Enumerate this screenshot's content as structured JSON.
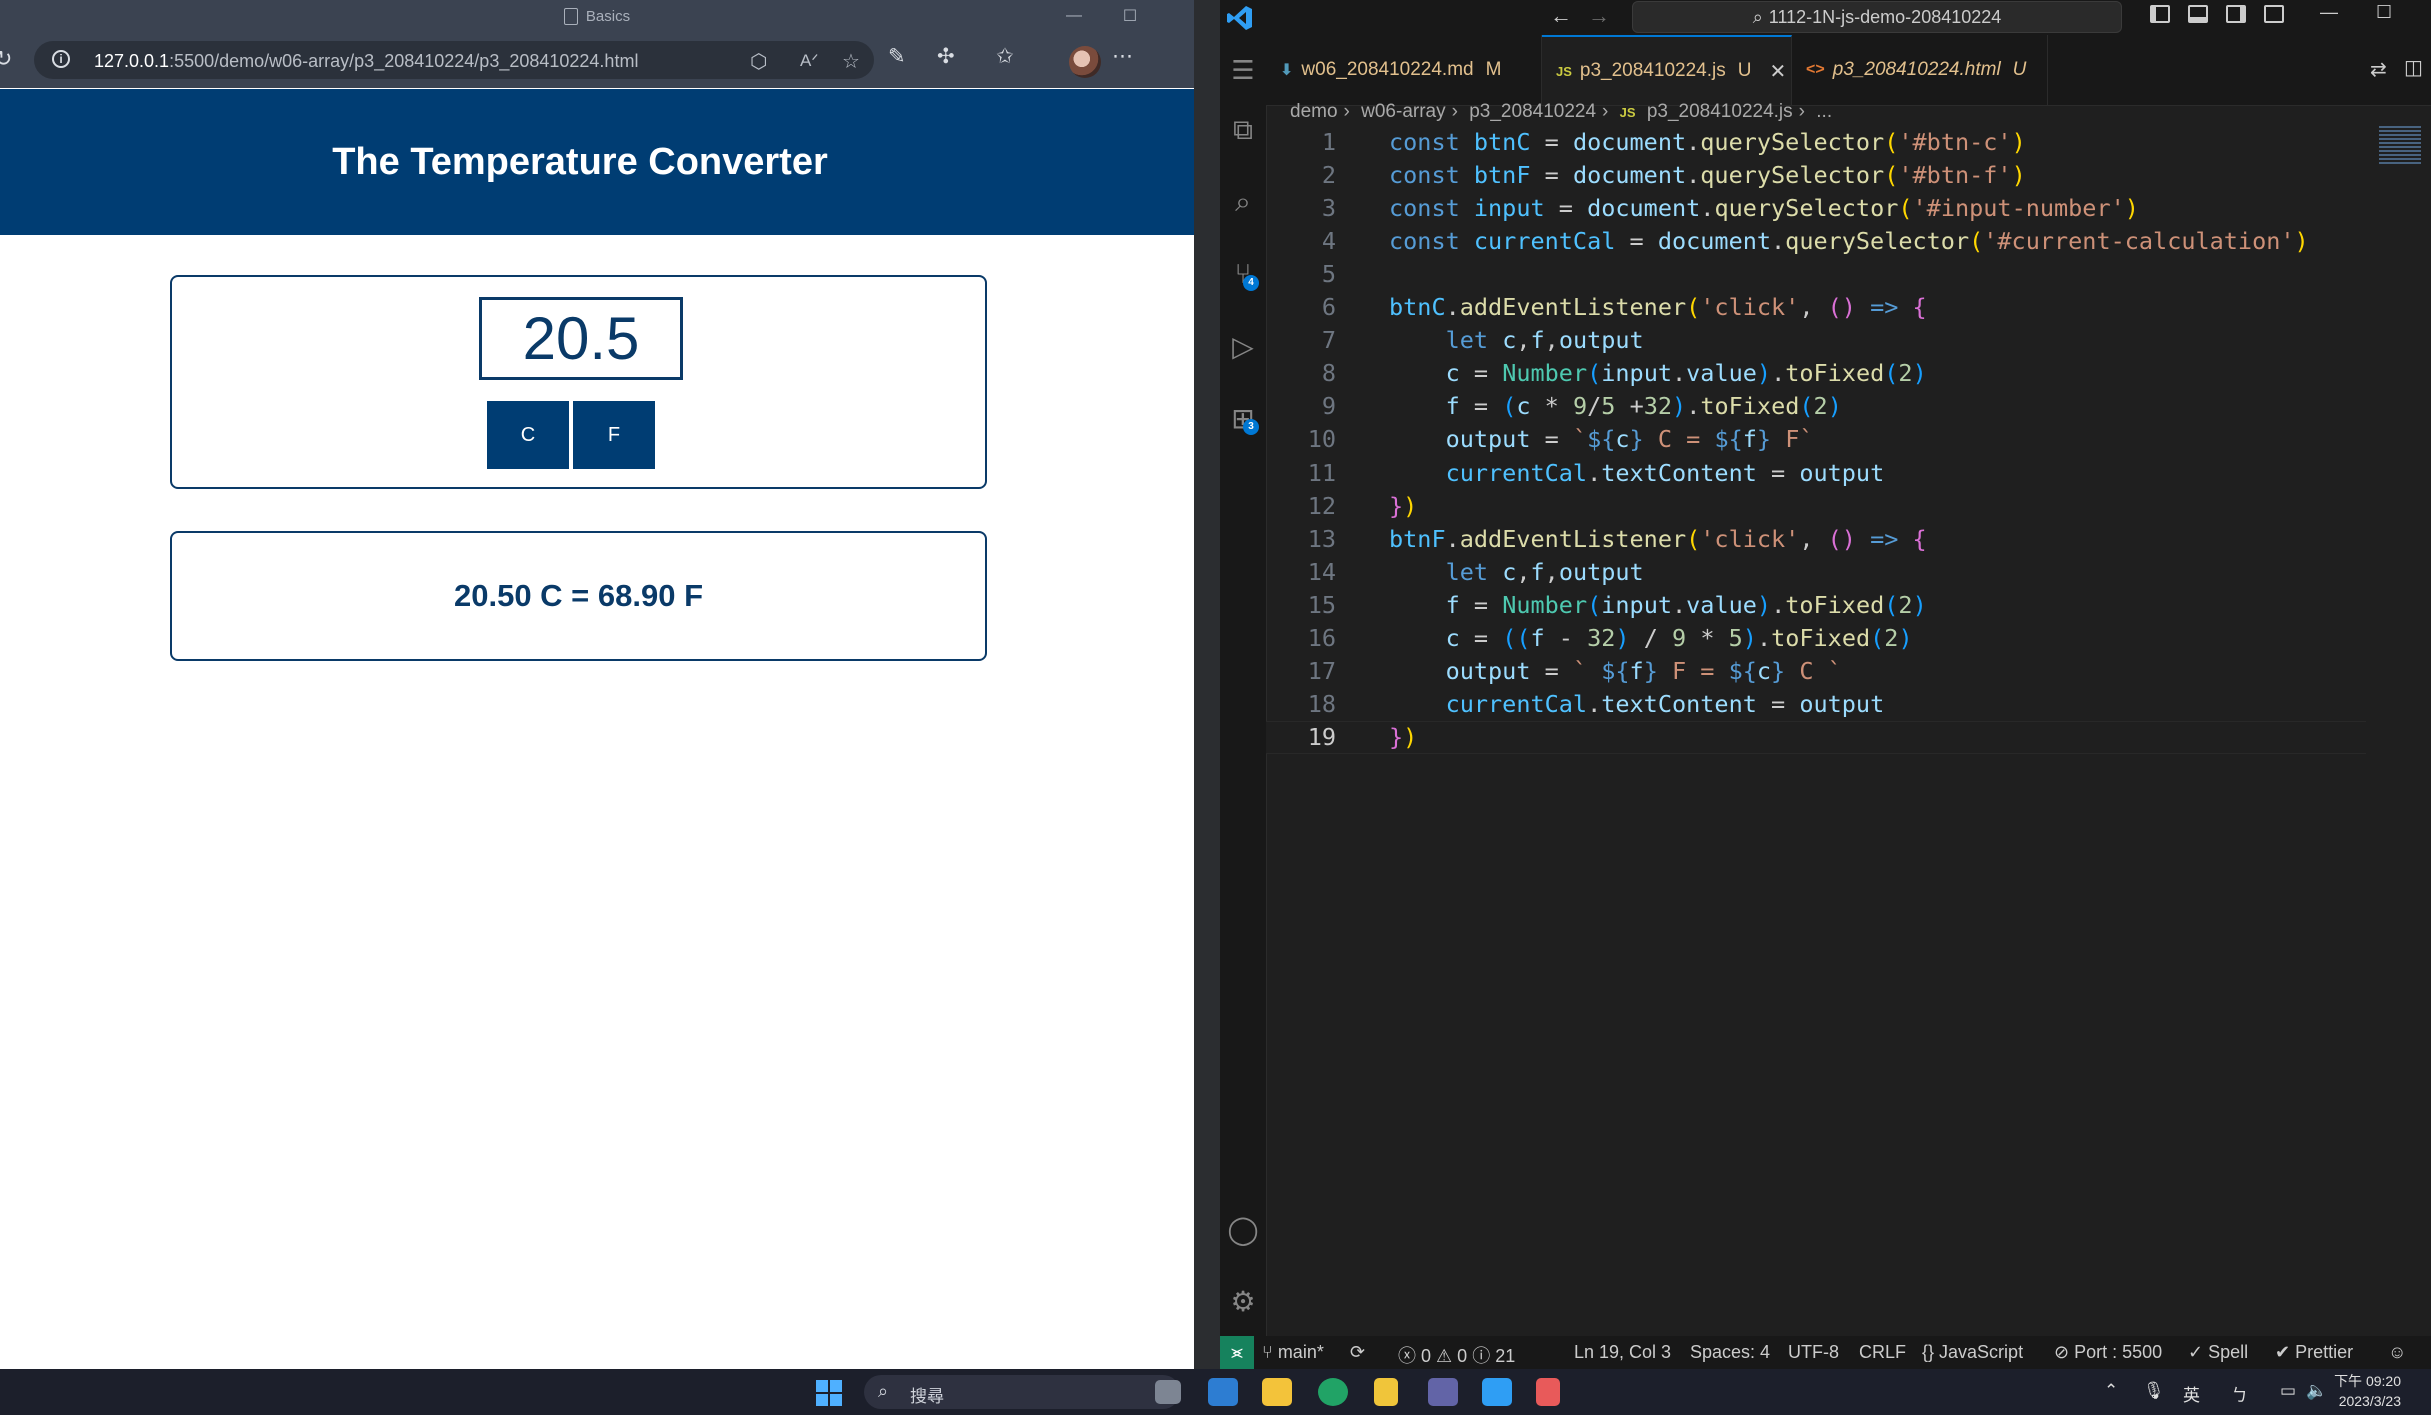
{
  "browser": {
    "window_title": "Basics",
    "url_host": "127.0.0.1",
    "url_rest": ":5500/demo/w06-array/p3_208410224/p3_208410224.html",
    "page": {
      "title": "The Temperature Converter",
      "input_value": "20.5",
      "btn_c": "C",
      "btn_f": "F",
      "result": "20.50 C = 68.90 F"
    }
  },
  "vscode": {
    "search_text": "1112-1N-js-demo-208410224",
    "tabs": [
      {
        "icon": "⬇",
        "label": "w06_208410224.md",
        "status": "M"
      },
      {
        "icon": "JS",
        "label": "p3_208410224.js",
        "status": "U"
      },
      {
        "icon": "<>",
        "label": "p3_208410224.html",
        "status": "U"
      }
    ],
    "breadcrumb": [
      "demo",
      "w06-array",
      "p3_208410224",
      "p3_208410224.js",
      "..."
    ],
    "badges": {
      "scm": "4",
      "extensions": "3"
    },
    "current_line": 19,
    "status": {
      "branch": "main*",
      "errors": "0",
      "warnings": "0",
      "infos": "21",
      "cursor": "Ln 19, Col 3",
      "spaces": "Spaces: 4",
      "encoding": "UTF-8",
      "eol": "CRLF",
      "language": "JavaScript",
      "port": "Port : 5500",
      "spell": "Spell",
      "prettier": "Prettier"
    },
    "code_lines": [
      [
        [
          "kw",
          "const "
        ],
        [
          "cst",
          "btnC"
        ],
        [
          "pl",
          " = "
        ],
        [
          "var",
          "document"
        ],
        [
          "pl",
          "."
        ],
        [
          "fn",
          "querySelector"
        ],
        [
          "b1",
          "("
        ],
        [
          "str",
          "'#btn-c'"
        ],
        [
          "b1",
          ")"
        ]
      ],
      [
        [
          "kw",
          "const "
        ],
        [
          "cst",
          "btnF"
        ],
        [
          "pl",
          " = "
        ],
        [
          "var",
          "document"
        ],
        [
          "pl",
          "."
        ],
        [
          "fn",
          "querySelector"
        ],
        [
          "b1",
          "("
        ],
        [
          "str",
          "'#btn-f'"
        ],
        [
          "b1",
          ")"
        ]
      ],
      [
        [
          "kw",
          "const "
        ],
        [
          "cst",
          "input"
        ],
        [
          "pl",
          " = "
        ],
        [
          "var",
          "document"
        ],
        [
          "pl",
          "."
        ],
        [
          "fn",
          "querySelector"
        ],
        [
          "b1",
          "("
        ],
        [
          "str",
          "'#input-number'"
        ],
        [
          "b1",
          ")"
        ]
      ],
      [
        [
          "kw",
          "const "
        ],
        [
          "cst",
          "currentCal"
        ],
        [
          "pl",
          " = "
        ],
        [
          "var",
          "document"
        ],
        [
          "pl",
          "."
        ],
        [
          "fn",
          "querySelector"
        ],
        [
          "b1",
          "("
        ],
        [
          "str",
          "'#current-calculation'"
        ],
        [
          "b1",
          ")"
        ]
      ],
      [],
      [
        [
          "cst",
          "btnC"
        ],
        [
          "pl",
          "."
        ],
        [
          "fn",
          "addEventListener"
        ],
        [
          "b1",
          "("
        ],
        [
          "str",
          "'click'"
        ],
        [
          "pl",
          ", "
        ],
        [
          "b2",
          "()"
        ],
        [
          "ar",
          " => "
        ],
        [
          "b2",
          "{"
        ]
      ],
      [
        [
          "pl",
          "    "
        ],
        [
          "kw",
          "let "
        ],
        [
          "var",
          "c"
        ],
        [
          "pl",
          ","
        ],
        [
          "var",
          "f"
        ],
        [
          "pl",
          ","
        ],
        [
          "var",
          "output"
        ]
      ],
      [
        [
          "pl",
          "    "
        ],
        [
          "var",
          "c"
        ],
        [
          "pl",
          " = "
        ],
        [
          "cls",
          "Number"
        ],
        [
          "b3",
          "("
        ],
        [
          "var",
          "input"
        ],
        [
          "pl",
          "."
        ],
        [
          "var",
          "value"
        ],
        [
          "b3",
          ")"
        ],
        [
          "pl",
          "."
        ],
        [
          "fn",
          "toFixed"
        ],
        [
          "b3",
          "("
        ],
        [
          "num",
          "2"
        ],
        [
          "b3",
          ")"
        ]
      ],
      [
        [
          "pl",
          "    "
        ],
        [
          "var",
          "f"
        ],
        [
          "pl",
          " = "
        ],
        [
          "b3",
          "("
        ],
        [
          "var",
          "c"
        ],
        [
          "pl",
          " * "
        ],
        [
          "num",
          "9"
        ],
        [
          "pl",
          "/"
        ],
        [
          "num",
          "5"
        ],
        [
          "pl",
          " +"
        ],
        [
          "num",
          "32"
        ],
        [
          "b3",
          ")"
        ],
        [
          "pl",
          "."
        ],
        [
          "fn",
          "toFixed"
        ],
        [
          "b3",
          "("
        ],
        [
          "num",
          "2"
        ],
        [
          "b3",
          ")"
        ]
      ],
      [
        [
          "pl",
          "    "
        ],
        [
          "var",
          "output"
        ],
        [
          "pl",
          " = "
        ],
        [
          "str",
          "`"
        ],
        [
          "kw",
          "${"
        ],
        [
          "var",
          "c"
        ],
        [
          "kw",
          "}"
        ],
        [
          "str",
          " C = "
        ],
        [
          "kw",
          "${"
        ],
        [
          "var",
          "f"
        ],
        [
          "kw",
          "}"
        ],
        [
          "str",
          " F`"
        ]
      ],
      [
        [
          "pl",
          "    "
        ],
        [
          "cst",
          "currentCal"
        ],
        [
          "pl",
          "."
        ],
        [
          "var",
          "textContent"
        ],
        [
          "pl",
          " = "
        ],
        [
          "var",
          "output"
        ]
      ],
      [
        [
          "b2",
          "}"
        ],
        [
          "b1",
          ")"
        ]
      ],
      [
        [
          "cst",
          "btnF"
        ],
        [
          "pl",
          "."
        ],
        [
          "fn",
          "addEventListener"
        ],
        [
          "b1",
          "("
        ],
        [
          "str",
          "'click'"
        ],
        [
          "pl",
          ", "
        ],
        [
          "b2",
          "()"
        ],
        [
          "ar",
          " => "
        ],
        [
          "b2",
          "{"
        ]
      ],
      [
        [
          "pl",
          "    "
        ],
        [
          "kw",
          "let "
        ],
        [
          "var",
          "c"
        ],
        [
          "pl",
          ","
        ],
        [
          "var",
          "f"
        ],
        [
          "pl",
          ","
        ],
        [
          "var",
          "output"
        ]
      ],
      [
        [
          "pl",
          "    "
        ],
        [
          "var",
          "f"
        ],
        [
          "pl",
          " = "
        ],
        [
          "cls",
          "Number"
        ],
        [
          "b3",
          "("
        ],
        [
          "var",
          "input"
        ],
        [
          "pl",
          "."
        ],
        [
          "var",
          "value"
        ],
        [
          "b3",
          ")"
        ],
        [
          "pl",
          "."
        ],
        [
          "fn",
          "toFixed"
        ],
        [
          "b3",
          "("
        ],
        [
          "num",
          "2"
        ],
        [
          "b3",
          ")"
        ]
      ],
      [
        [
          "pl",
          "    "
        ],
        [
          "var",
          "c"
        ],
        [
          "pl",
          " = "
        ],
        [
          "b3",
          "(("
        ],
        [
          "var",
          "f"
        ],
        [
          "pl",
          " - "
        ],
        [
          "num",
          "32"
        ],
        [
          "b3",
          ")"
        ],
        [
          "pl",
          " / "
        ],
        [
          "num",
          "9"
        ],
        [
          "pl",
          " * "
        ],
        [
          "num",
          "5"
        ],
        [
          "b3",
          ")"
        ],
        [
          "pl",
          "."
        ],
        [
          "fn",
          "toFixed"
        ],
        [
          "b3",
          "("
        ],
        [
          "num",
          "2"
        ],
        [
          "b3",
          ")"
        ]
      ],
      [
        [
          "pl",
          "    "
        ],
        [
          "var",
          "output"
        ],
        [
          "pl",
          " = "
        ],
        [
          "str",
          "` "
        ],
        [
          "kw",
          "${"
        ],
        [
          "var",
          "f"
        ],
        [
          "kw",
          "}"
        ],
        [
          "str",
          " F = "
        ],
        [
          "kw",
          "${"
        ],
        [
          "var",
          "c"
        ],
        [
          "kw",
          "}"
        ],
        [
          "str",
          " C `"
        ]
      ],
      [
        [
          "pl",
          "    "
        ],
        [
          "cst",
          "currentCal"
        ],
        [
          "pl",
          "."
        ],
        [
          "var",
          "textContent"
        ],
        [
          "pl",
          " = "
        ],
        [
          "var",
          "output"
        ]
      ],
      [
        [
          "b2",
          "}"
        ],
        [
          "b1",
          ")"
        ]
      ]
    ]
  },
  "taskbar": {
    "search_label": "搜尋",
    "ime": "英",
    "time": "下午 09:20",
    "date": "2023/3/23"
  },
  "colors": {
    "header_blue": "#003d73",
    "accent": "#0078d4",
    "remote": "#16825d"
  }
}
